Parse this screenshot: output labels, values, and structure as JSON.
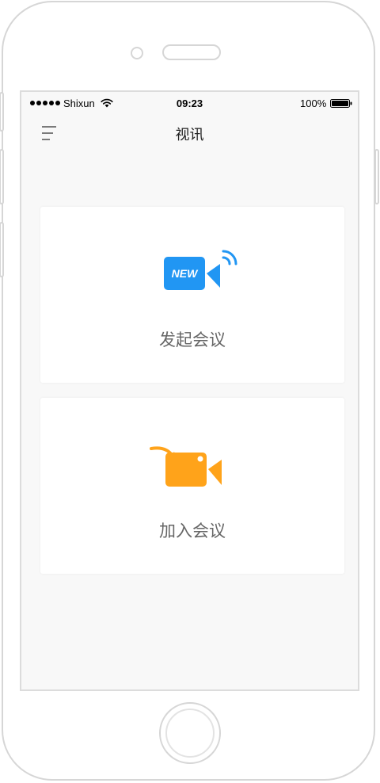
{
  "status_bar": {
    "carrier": "Shixun",
    "time": "09:23",
    "battery": "100%",
    "signal_icon": "signal-dots-icon",
    "wifi_icon": "wifi-icon",
    "battery_icon": "battery-icon"
  },
  "nav": {
    "title": "视讯",
    "menu_icon": "hamburger-menu-icon"
  },
  "cards": [
    {
      "label": "发起会议",
      "icon": "new-meeting-camera-icon",
      "icon_text": "NEW",
      "color": "#2196f3"
    },
    {
      "label": "加入会议",
      "icon": "join-meeting-camera-icon",
      "color": "#ffa31a"
    }
  ],
  "colors": {
    "screen_bg": "#f8f8f8",
    "card_bg": "#ffffff",
    "label_text": "#666666",
    "frame": "#d6d6d6"
  }
}
